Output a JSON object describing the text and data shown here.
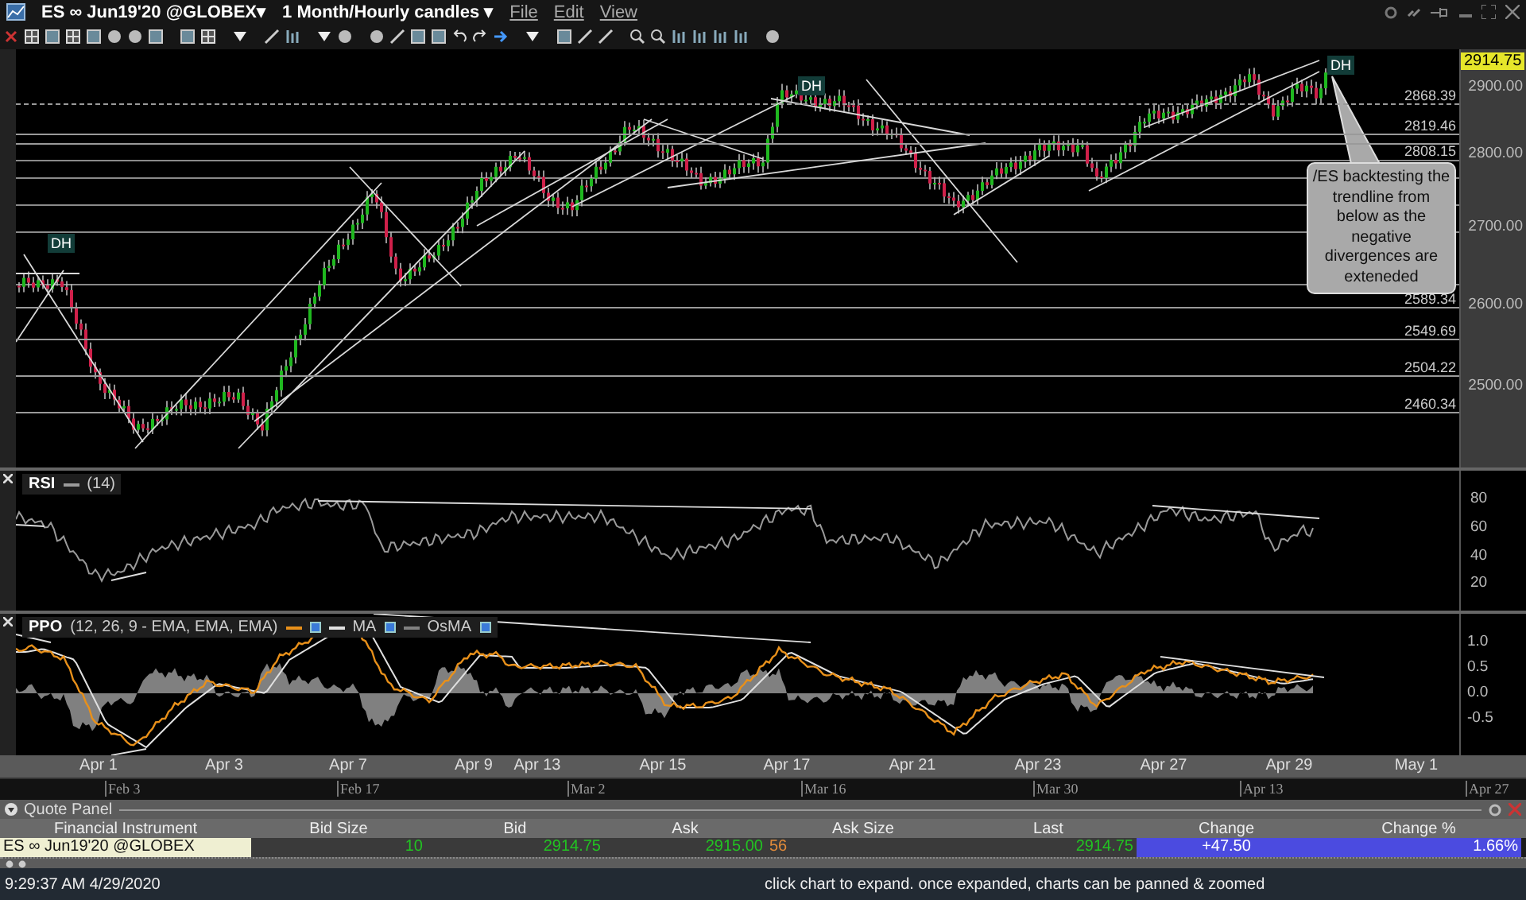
{
  "window": {
    "symbol": "ES ∞ Jun19'20 @GLOBEX▾",
    "timeframe": "1 Month/Hourly candles ▾",
    "menus": [
      "File",
      "Edit",
      "View"
    ]
  },
  "price_chart": {
    "last_price": "2914.75",
    "y_axis": [
      "2900.00",
      "2800.00",
      "2700.00",
      "2600.00",
      "2500.00"
    ],
    "levels": [
      {
        "label": "2868.39",
        "dashed": true
      },
      {
        "label": "2819.46",
        "dashed": false
      },
      {
        "label": "2808.15",
        "dashed": false
      },
      {
        "label": "2589.34",
        "dashed": false
      },
      {
        "label": "2549.69",
        "dashed": false
      },
      {
        "label": "2504.22",
        "dashed": false
      },
      {
        "label": "2460.34",
        "dashed": false
      }
    ],
    "markers": [
      "DH",
      "DH",
      "DH"
    ],
    "callout": "/ES backtesting the trendline from below as the negative divergences are exteneded"
  },
  "rsi": {
    "name": "RSI",
    "params": "(14)",
    "y_axis": [
      "80",
      "60",
      "40",
      "20"
    ]
  },
  "ppo": {
    "name": "PPO",
    "params": "(12, 26, 9 - EMA, EMA, EMA)",
    "legend": [
      {
        "color": "#e8901a",
        "checked": true
      },
      {
        "label": "MA",
        "color": "#e0e0e0",
        "checked": true
      },
      {
        "label": "OsMA",
        "color": "#808080",
        "checked": true
      }
    ],
    "y_axis": [
      "1.0",
      "0.5",
      "0.0",
      "-0.5"
    ]
  },
  "dates": [
    "Apr 1",
    "Apr 3",
    "Apr 7",
    "Apr 9",
    "Apr 13",
    "Apr 15",
    "Apr 17",
    "Apr 21",
    "Apr 23",
    "Apr 27",
    "Apr 29",
    "May 1"
  ],
  "navigator": [
    "Feb 3",
    "Feb 17",
    "Mar 2",
    "Mar 16",
    "Mar 30",
    "Apr 13",
    "Apr 27"
  ],
  "quote_panel": {
    "title": "Quote Panel",
    "columns": [
      "Financial Instrument",
      "Bid Size",
      "Bid",
      "Ask",
      "Ask Size",
      "Last",
      "Change",
      "Change %"
    ],
    "rows": [
      {
        "cells": [
          "ES ∞ Jun19'20 @GLOBEX",
          "10",
          "2914.75",
          "2915.00",
          "56",
          "2914.75",
          "+47.50",
          "1.66%"
        ]
      }
    ]
  },
  "status_bar": {
    "time": "9:29:37 AM 4/29/2020",
    "hint": "click chart to expand. once expanded, charts can be panned & zoomed"
  }
}
